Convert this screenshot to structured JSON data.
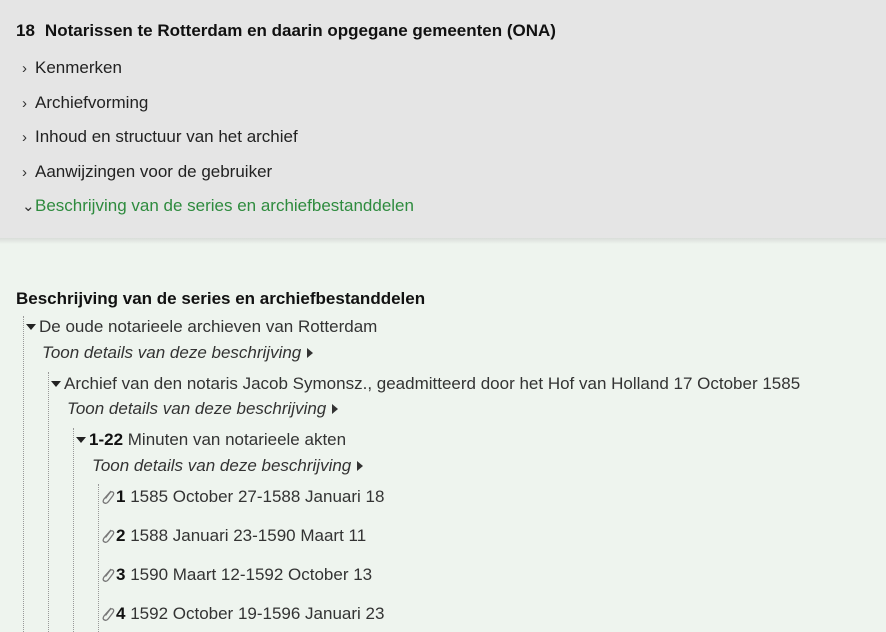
{
  "archive": {
    "number": "18",
    "title": "Notarissen te Rotterdam en daarin opgegane gemeenten (ONA)"
  },
  "sections": [
    {
      "label": "Kenmerken",
      "expanded": false
    },
    {
      "label": "Archiefvorming",
      "expanded": false
    },
    {
      "label": "Inhoud en structuur van het archief",
      "expanded": false
    },
    {
      "label": "Aanwijzingen voor de gebruiker",
      "expanded": false
    },
    {
      "label": "Beschrijving van de series en archiefbestanddelen",
      "expanded": true
    }
  ],
  "main": {
    "heading": "Beschrijving van de series en archiefbestanddelen",
    "details_label": "Toon details van deze beschrijving",
    "tree": {
      "level1": "De oude notarieele archieven van Rotterdam",
      "level2": "Archief van den notaris Jacob Symonsz., geadmitteerd door het Hof van Holland 17 October 1585",
      "level3": {
        "code": "1-22",
        "title": "Minuten van notarieele akten"
      },
      "items": [
        {
          "number": "1",
          "date": "1585 October 27-1588 Januari 18"
        },
        {
          "number": "2",
          "date": "1588 Januari 23-1590 Maart 11"
        },
        {
          "number": "3",
          "date": "1590 Maart 12-1592 October 13"
        },
        {
          "number": "4",
          "date": "1592 October 19-1596 Januari 23"
        }
      ]
    }
  },
  "colors": {
    "active_link": "#2e8b3e",
    "top_bg": "#e5e5e5",
    "content_bg": "#eef4ee"
  },
  "icons": {
    "collapsed": "chevron-right-icon",
    "expanded": "chevron-down-icon",
    "item": "paperclip-icon"
  }
}
